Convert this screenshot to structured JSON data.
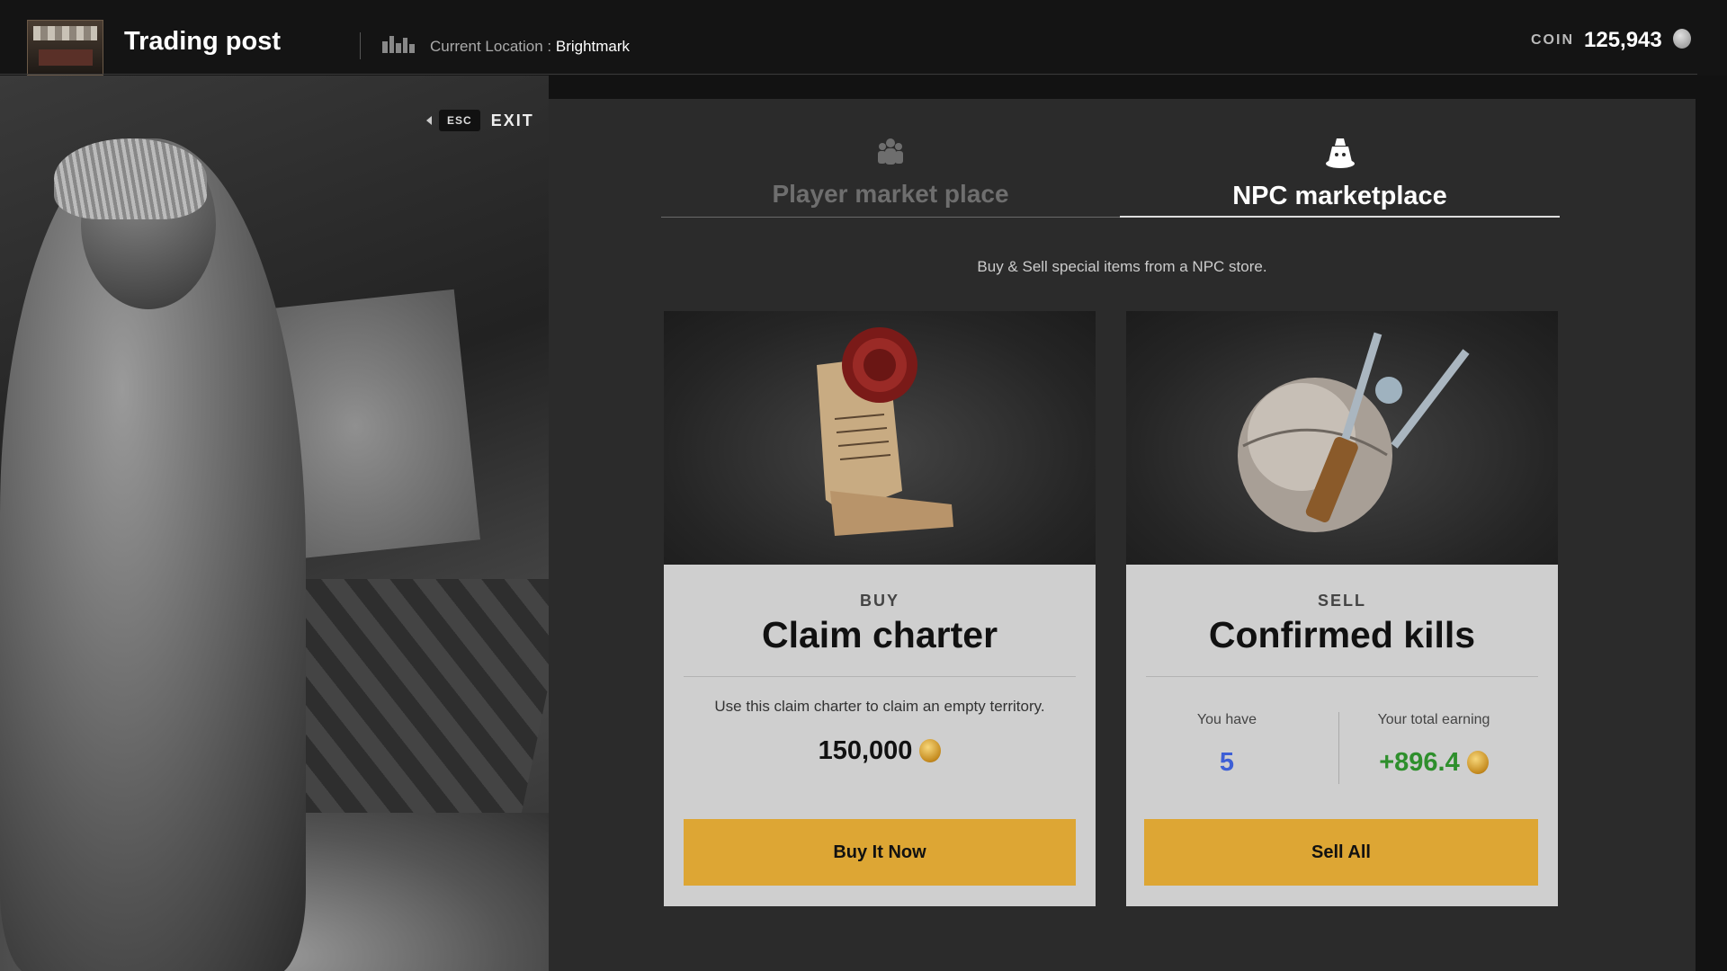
{
  "header": {
    "title": "Trading post",
    "location_label": "Current Location : ",
    "location_value": "Brightmark",
    "coin_label": "COIN",
    "coin_value": "125,943",
    "logo_icon": "trading-post-stall-icon",
    "location_icon": "city-icon",
    "coin_icon": "silver-coin-icon"
  },
  "exit": {
    "key": "ESC",
    "label": "EXIT"
  },
  "tabs": [
    {
      "label": "Player market place",
      "icon": "players-group-icon",
      "active": false
    },
    {
      "label": "NPC marketplace",
      "icon": "npc-merchant-icon",
      "active": true
    }
  ],
  "subtitle": "Buy & Sell special items from a NPC store.",
  "buy_card": {
    "kind": "BUY",
    "name": "Claim charter",
    "description": "Use this claim charter to claim an empty territory.",
    "price": "150,000",
    "button": "Buy It Now",
    "art_icon": "sealed-scroll-icon"
  },
  "sell_card": {
    "kind": "SELL",
    "name": "Confirmed kills",
    "you_have_label": "You have",
    "you_have_value": "5",
    "earning_label": "Your total earning",
    "earning_value": "+896.4",
    "button": "Sell All",
    "art_icon": "orb-and-spear-icon"
  },
  "colors": {
    "accent_button": "#dda634",
    "count_blue": "#3d5fd6",
    "earning_green": "#2e8f2c",
    "panel_bg": "#2b2b2b"
  }
}
